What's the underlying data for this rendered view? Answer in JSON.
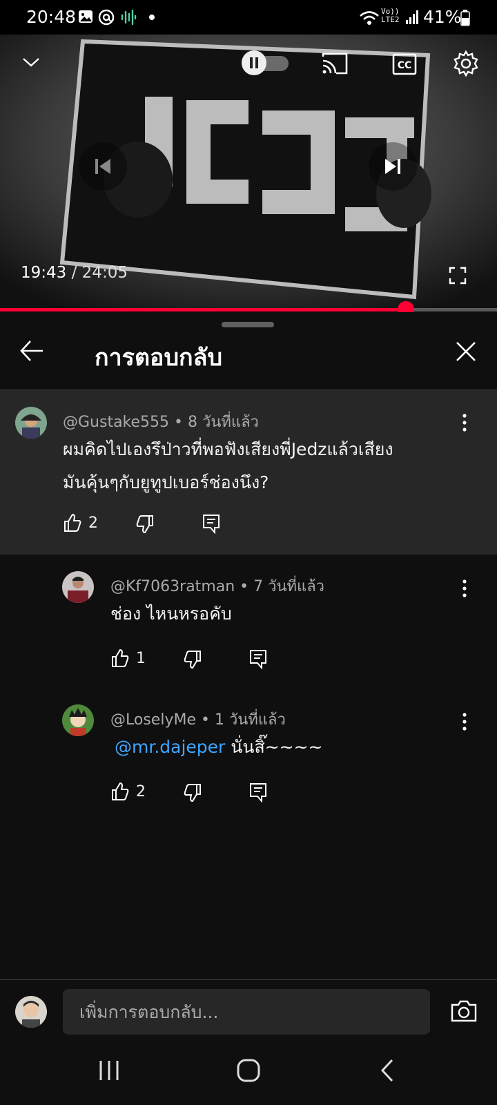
{
  "status_bar": {
    "time": "20:48",
    "battery": "41%",
    "network_badge_top": "Vo))",
    "network_badge_bottom": "LTE2",
    "icons": [
      "gallery-icon",
      "threads-icon",
      "audio-wave-icon",
      "dot-icon",
      "wifi-icon",
      "signal-icon",
      "battery-icon"
    ]
  },
  "player": {
    "current_time": "19:43",
    "separator": " / ",
    "duration": "24:05",
    "progress": 0.817,
    "autoplay_paused": true,
    "icons": [
      "chevron-down-icon",
      "autoplay-toggle",
      "cast-icon",
      "cc-icon",
      "gear-icon",
      "previous-icon",
      "next-icon",
      "fullscreen-icon"
    ]
  },
  "panel": {
    "title": "การตอบกลับ"
  },
  "comments": [
    {
      "author": "@Gustake555",
      "age": "8 วันที่แล้ว",
      "lines": [
        "ผมคิดไปเองรึป่าวที่พอฟังเสียงพี่Jedzแล้วเสียง",
        "มันคุ้นๆกับยูทูปเบอร์ช่องนึง?"
      ],
      "likes": "2"
    },
    {
      "author": "@Kf7063ratman",
      "age": "7 วันที่แล้ว",
      "text": "ช่อง ไหนหรอคับ",
      "likes": "1"
    },
    {
      "author": "@LoselyMe",
      "age": "1 วันที่แล้ว",
      "mention": "@mr.dajeper",
      "text": " นั่นสิ๊~~~~",
      "likes": "2"
    }
  ],
  "meta_separator": " • ",
  "composer": {
    "placeholder": "เพิ่มการตอบกลับ..."
  },
  "colors": {
    "background": "#0f0f0f",
    "highlight": "#272727",
    "accent_red": "#ff0033",
    "mention_blue": "#3ea6ff",
    "meta_gray": "#aaaaaa"
  }
}
